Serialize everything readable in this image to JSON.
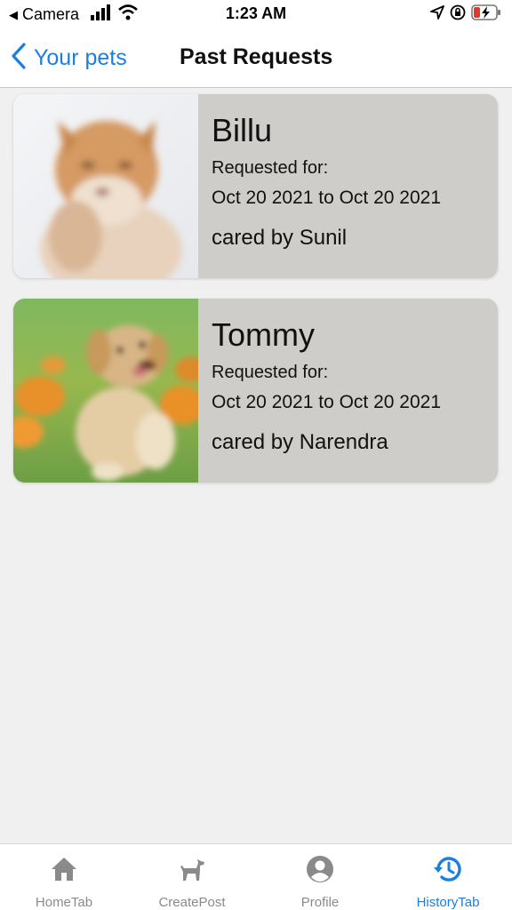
{
  "status_bar": {
    "back_app": "Camera",
    "time": "1:23 AM",
    "icons": [
      "signal-icon",
      "wifi-icon",
      "location-icon",
      "orientation-lock-icon",
      "battery-icon"
    ]
  },
  "header": {
    "back_label": "Your pets",
    "title": "Past Requests"
  },
  "requests": [
    {
      "pet_name": "Billu",
      "requested_label": "Requested for:",
      "dates": "Oct 20 2021 to Oct 20 2021",
      "caretaker": "cared by Sunil",
      "photo": "cat-photo"
    },
    {
      "pet_name": "Tommy",
      "requested_label": "Requested for:",
      "dates": "Oct 20 2021 to Oct 20 2021",
      "caretaker": "cared by Narendra",
      "photo": "dog-photo"
    }
  ],
  "tabs": [
    {
      "label": "HomeTab",
      "icon": "home-icon",
      "active": false
    },
    {
      "label": "CreatePost",
      "icon": "dog-icon",
      "active": false
    },
    {
      "label": "Profile",
      "icon": "profile-icon",
      "active": false
    },
    {
      "label": "HistoryTab",
      "icon": "history-icon",
      "active": true
    }
  ],
  "colors": {
    "accent": "#1a7fe0",
    "card_background": "#cfcdc9",
    "screen_background": "#f0f0f0",
    "inactive_tab": "#8a8a8a"
  }
}
